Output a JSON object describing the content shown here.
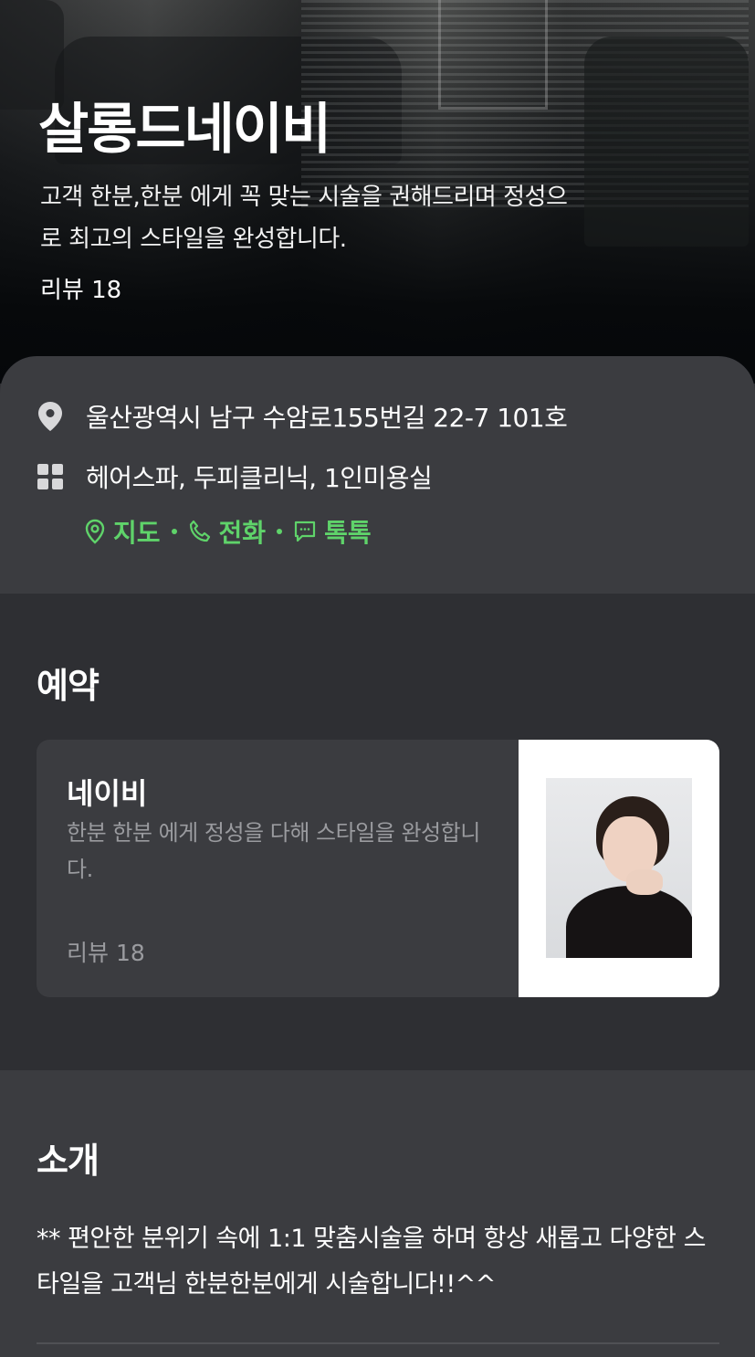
{
  "hero": {
    "title": "살롱드네이비",
    "description": "고객 한분,한분 에게 꼭 맞는 시술을 권해드리며 정성으로 최고의 스타일을 완성합니다.",
    "review_label": "리뷰 18"
  },
  "info": {
    "address": "울산광역시 남구 수암로155번길 22-7 101호",
    "categories": "헤어스파, 두피클리닉, 1인미용실",
    "links": {
      "map": "지도",
      "phone": "전화",
      "talk": "톡톡"
    },
    "icons": [
      "location-pin-icon",
      "grid-icon",
      "map-pin-outline-icon",
      "phone-icon",
      "chat-bubble-icon"
    ]
  },
  "reservation": {
    "section_title": "예약",
    "card": {
      "name": "네이비",
      "description": "한분 한분 에게 정성을 다해 스타일을 완성합니다.",
      "review_label": "리뷰 18"
    }
  },
  "intro": {
    "section_title": "소개",
    "text": "** 편안한 분위기 속에 1:1 맞춤시술을 하며 항상 새롭고 다양한 스타일을 고객님 한분한분에게 시술합니다!!^^"
  },
  "colors": {
    "accent_green": "#5fd36a",
    "background": "#2e2f33",
    "card": "#3b3c40",
    "muted_text": "#9a9b9f"
  }
}
